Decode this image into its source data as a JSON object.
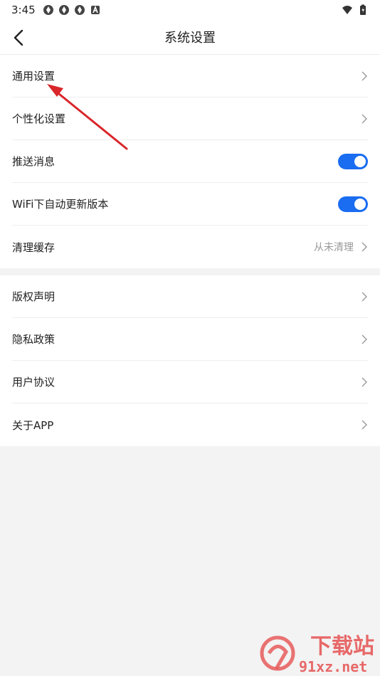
{
  "status": {
    "time": "3:45"
  },
  "header": {
    "title": "系统设置"
  },
  "group1": [
    {
      "label": "通用设置",
      "kind": "chevron"
    },
    {
      "label": "个性化设置",
      "kind": "chevron"
    },
    {
      "label": "推送消息",
      "kind": "toggle",
      "on": true
    },
    {
      "label": "WiFi下自动更新版本",
      "kind": "toggle",
      "on": true
    },
    {
      "label": "清理缓存",
      "kind": "value",
      "value": "从未清理"
    }
  ],
  "group2": [
    {
      "label": "版权声明"
    },
    {
      "label": "隐私政策"
    },
    {
      "label": "用户协议"
    },
    {
      "label": "关于APP"
    }
  ],
  "watermark": {
    "site": "下载站",
    "domain": "91xz.net"
  },
  "colors": {
    "accent": "#1a6cf0",
    "annotation": "#d9262a"
  }
}
